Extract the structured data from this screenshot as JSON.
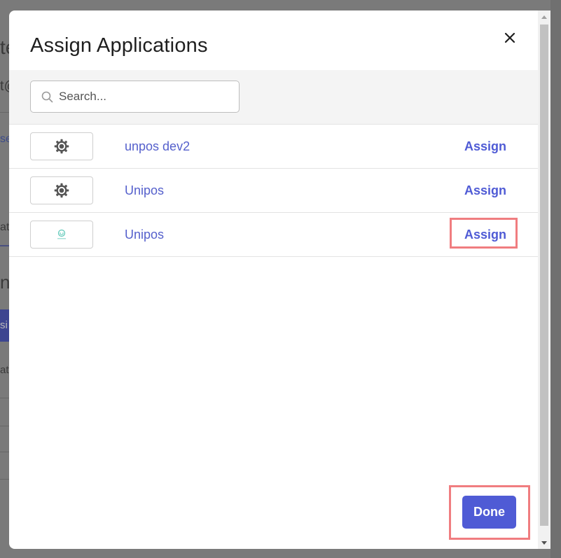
{
  "background": {
    "fragments": [
      "te",
      "t@",
      "se",
      "at",
      "n",
      "si",
      "at"
    ]
  },
  "modal": {
    "title": "Assign Applications",
    "close_icon": "close-icon",
    "search": {
      "placeholder": "Search...",
      "value": "",
      "icon": "search-icon"
    },
    "applications": [
      {
        "name": "unpos dev2",
        "icon": "gear-icon",
        "action": "Assign"
      },
      {
        "name": "Unipos",
        "icon": "gear-icon",
        "action": "Assign"
      },
      {
        "name": "Unipos",
        "icon": "unipos-logo-icon",
        "action": "Assign"
      }
    ],
    "done_label": "Done"
  },
  "colors": {
    "accent": "#4f5bd5",
    "link": "#5560cc",
    "highlight": "#f07d80"
  }
}
